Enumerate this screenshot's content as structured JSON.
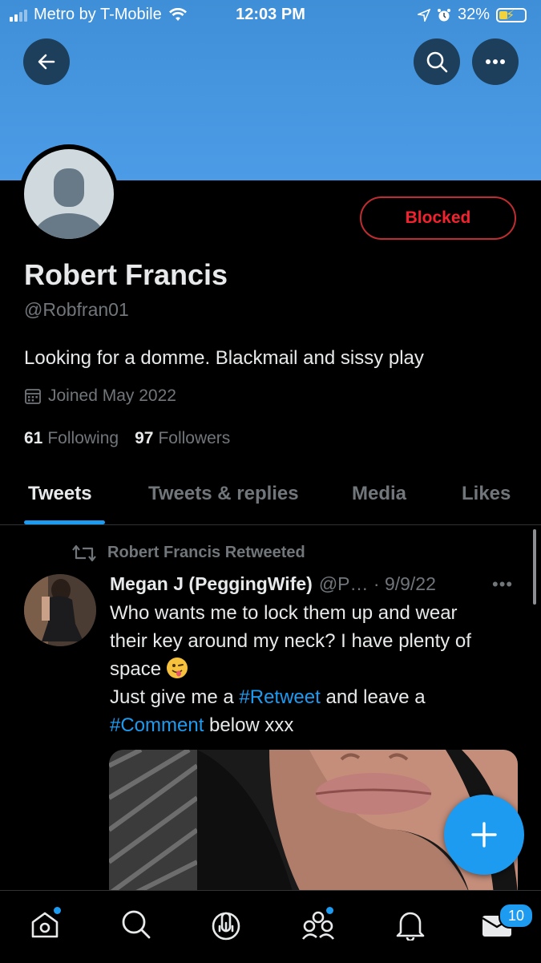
{
  "status_bar": {
    "carrier": "Metro by T-Mobile",
    "time": "12:03 PM",
    "battery": "32%",
    "icons": [
      "signal-icon",
      "wifi-icon",
      "location-icon",
      "alarm-icon",
      "battery-charging-icon"
    ],
    "battery_level": 0.32
  },
  "header": {
    "icons": [
      "back-arrow-icon",
      "search-icon",
      "more-icon"
    ]
  },
  "profile": {
    "name": "Robert Francis",
    "handle": "@Robfran01",
    "bio": "Looking for a domme. Blackmail and sissy play",
    "joined": "Joined May 2022",
    "following_count": "61",
    "following_label": "Following",
    "followers_count": "97",
    "followers_label": "Followers",
    "action_button": "Blocked"
  },
  "tabs": [
    {
      "label": "Tweets",
      "active": true
    },
    {
      "label": "Tweets & replies",
      "active": false
    },
    {
      "label": "Media",
      "active": false
    },
    {
      "label": "Likes",
      "active": false
    }
  ],
  "tweet": {
    "retweet_label": "Robert Francis Retweeted",
    "author": "Megan J (PeggingWife)",
    "handle_date": "@P… · 9/9/22",
    "line1": "Who wants me to lock them up and wear",
    "line2": "their key around my neck? I have plenty of",
    "line3": "space",
    "line4_pre": "Just give me a ",
    "hashtag1": "#Retweet",
    "line4_post": " and leave a",
    "hashtag2": "#Comment",
    "line5_post": " below xxx"
  },
  "bottom_nav": {
    "items": [
      "home-icon",
      "search-icon",
      "spaces-icon",
      "communities-icon",
      "notifications-icon",
      "messages-icon"
    ],
    "messages_badge": "10"
  },
  "colors": {
    "accent": "#1d9bf0",
    "blocked_red": "#f4212e",
    "banner_blue": "#4b9be6",
    "muted": "#71767b"
  }
}
